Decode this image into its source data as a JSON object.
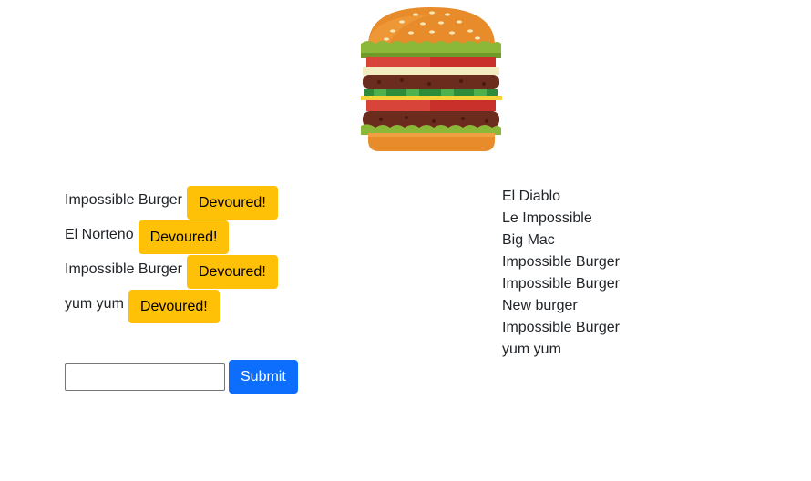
{
  "logo": {
    "icon": "hamburger-logo-icon"
  },
  "uneaten": {
    "items": [
      {
        "name": "Impossible Burger",
        "button": "Devoured!"
      },
      {
        "name": "El Norteno",
        "button": "Devoured!"
      },
      {
        "name": "Impossible Burger",
        "button": "Devoured!"
      },
      {
        "name": "yum yum",
        "button": "Devoured!"
      }
    ]
  },
  "form": {
    "input_value": "",
    "submit_label": "Submit"
  },
  "devoured": {
    "items": [
      "El Diablo",
      "Le Impossible",
      "Big Mac",
      "Impossible Burger",
      "Impossible Burger",
      "New burger",
      "Impossible Burger",
      "yum yum"
    ]
  },
  "colors": {
    "devour_button": "#ffc107",
    "submit_button": "#0d6efd"
  }
}
